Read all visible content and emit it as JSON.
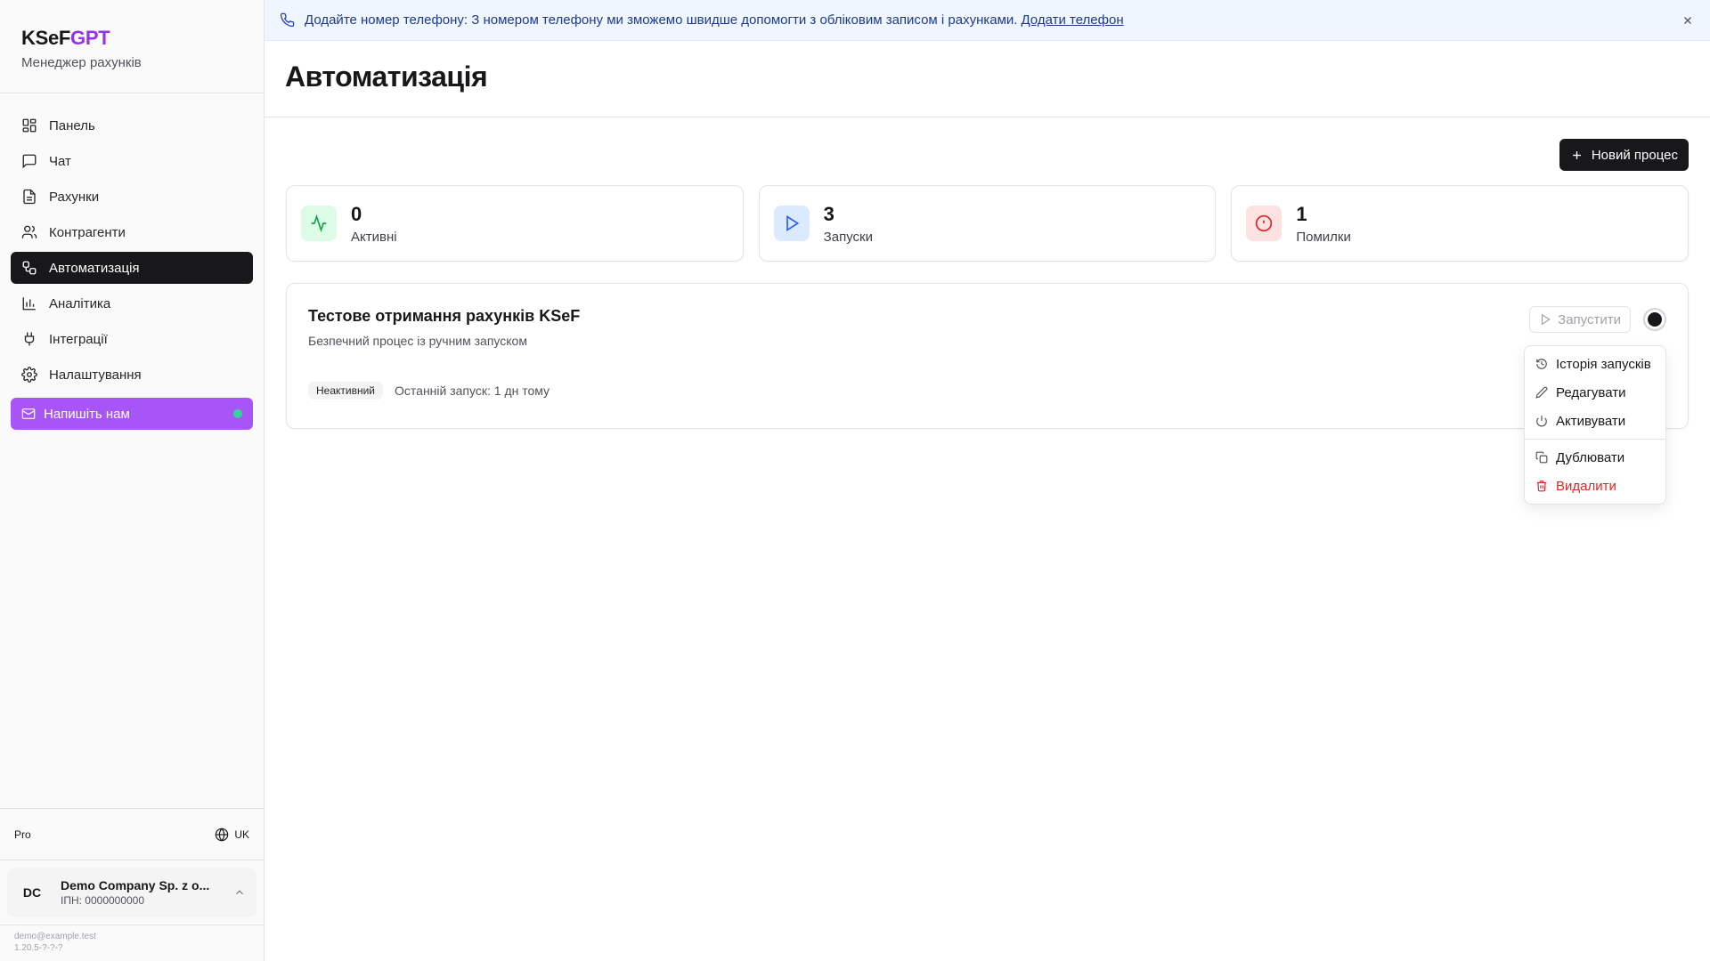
{
  "brand": {
    "name_part1": "KSeF",
    "name_part2": "GPT",
    "subtitle": "Менеджер рахунків"
  },
  "sidebar": {
    "items": [
      {
        "label": "Панель",
        "icon": "dashboard-icon"
      },
      {
        "label": "Чат",
        "icon": "chat-icon"
      },
      {
        "label": "Рахунки",
        "icon": "file-text-icon"
      },
      {
        "label": "Контрагенти",
        "icon": "users-icon"
      },
      {
        "label": "Автоматизація",
        "icon": "workflow-icon",
        "active": true
      },
      {
        "label": "Аналітика",
        "icon": "bar-chart-icon"
      },
      {
        "label": "Інтеграції",
        "icon": "plug-icon"
      },
      {
        "label": "Налаштування",
        "icon": "gear-icon"
      }
    ],
    "contact_label": "Напишіть нам",
    "plan": "Pro",
    "language": "UK",
    "company": {
      "initials": "DC",
      "name": "Demo Company Sp. z o...",
      "tax_id": "ІПН: 0000000000"
    },
    "email": "demo@example.test",
    "version": "1.20.5-?-?-?"
  },
  "banner": {
    "text": "Додайте номер телефону: З номером телефону ми зможемо швидше допомогти з обліковим записом і рахунками.",
    "link": "Додати телефон"
  },
  "page": {
    "title": "Автоматизація",
    "new_button": "Новий процес"
  },
  "stats": [
    {
      "value": "0",
      "label": "Активні",
      "color": "#16a34a",
      "bg": "#dcfce7",
      "icon": "activity-icon"
    },
    {
      "value": "3",
      "label": "Запуски",
      "color": "#2563eb",
      "bg": "#dbeafe",
      "icon": "play-icon"
    },
    {
      "value": "1",
      "label": "Помилки",
      "color": "#dc2626",
      "bg": "#fee2e2",
      "icon": "alert-circle-icon"
    }
  ],
  "process": {
    "title": "Тестове отримання рахунків KSeF",
    "description": "Безпечний процес із ручним запуском",
    "status": "Неактивний",
    "last_run": "Останній запуск: 1 дн тому",
    "run_label": "Запустити"
  },
  "menu": {
    "items": [
      {
        "label": "Історія запусків",
        "icon": "history-icon"
      },
      {
        "label": "Редагувати",
        "icon": "pencil-icon"
      },
      {
        "label": "Активувати",
        "icon": "power-icon"
      },
      {
        "label": "Дублювати",
        "icon": "copy-icon"
      },
      {
        "label": "Видалити",
        "icon": "trash-icon",
        "danger": true
      }
    ]
  }
}
